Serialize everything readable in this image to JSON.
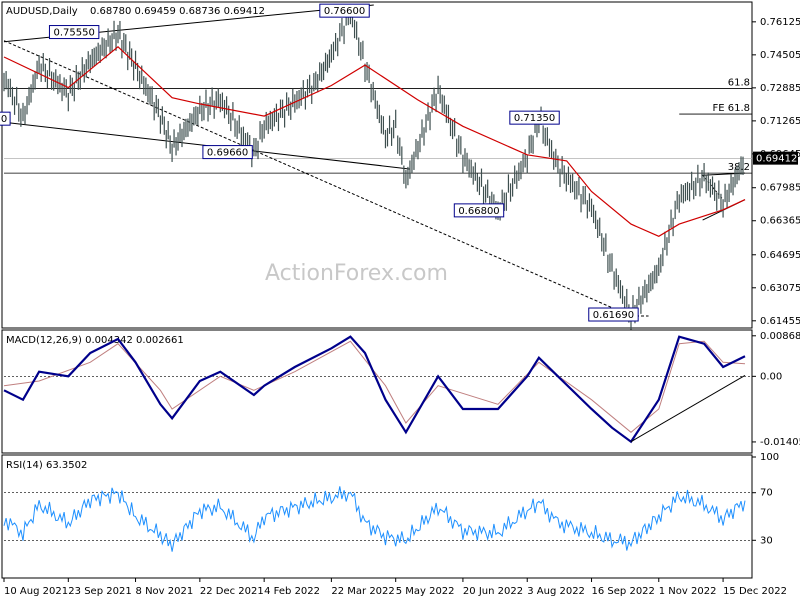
{
  "chart_data": {
    "type": "line",
    "instrument": "AUDUSD,Daily",
    "ohlc_header": "0.68780 0.69459 0.68736 0.69412",
    "watermark": "ActionForex.com",
    "x_ticks": [
      "10 Aug 2021",
      "23 Sep 2021",
      "8 Nov 2021",
      "22 Dec 2021",
      "4 Feb 2022",
      "22 Mar 2022",
      "5 May 2022",
      "20 Jun 2022",
      "3 Aug 2022",
      "16 Sep 2022",
      "1 Nov 2022",
      "15 Dec 2022"
    ],
    "price_panel": {
      "ylim": [
        0.612,
        0.77
      ],
      "y_ticks": [
        "0.76125",
        "0.74505",
        "0.72885",
        "0.71265",
        "0.69645",
        "0.67985",
        "0.66365",
        "0.64695",
        "0.63075",
        "0.61455"
      ],
      "last_price": "0.69412",
      "close_path": [
        [
          "10 Aug 2021",
          0.734
        ],
        [
          "23 Aug 2021",
          0.714
        ],
        [
          "3 Sep 2021",
          0.74
        ],
        [
          "23 Sep 2021",
          0.726
        ],
        [
          "8 Oct 2021",
          0.742
        ],
        [
          "27 Oct 2021",
          0.7555
        ],
        [
          "8 Nov 2021",
          0.739
        ],
        [
          "25 Nov 2021",
          0.715
        ],
        [
          "3 Dec 2021",
          0.6993
        ],
        [
          "22 Dec 2021",
          0.718
        ],
        [
          "5 Jan 2022",
          0.723
        ],
        [
          "28 Jan 2022",
          0.6966
        ],
        [
          "4 Feb 2022",
          0.71
        ],
        [
          "25 Feb 2022",
          0.722
        ],
        [
          "10 Mar 2022",
          0.73
        ],
        [
          "22 Mar 2022",
          0.745
        ],
        [
          "4 Apr 2022",
          0.766
        ],
        [
          "14 Apr 2022",
          0.74
        ],
        [
          "28 Apr 2022",
          0.705
        ],
        [
          "5 May 2022",
          0.71
        ],
        [
          "12 May 2022",
          0.683
        ],
        [
          "3 Jun 2022",
          0.728
        ],
        [
          "20 Jun 2022",
          0.695
        ],
        [
          "14 Jul 2022",
          0.668
        ],
        [
          "3 Aug 2022",
          0.695
        ],
        [
          "11 Aug 2022",
          0.7135
        ],
        [
          "24 Aug 2022",
          0.69
        ],
        [
          "16 Sep 2022",
          0.67
        ],
        [
          "30 Sep 2022",
          0.64
        ],
        [
          "13 Oct 2022",
          0.6169
        ],
        [
          "1 Nov 2022",
          0.64
        ],
        [
          "15 Nov 2022",
          0.675
        ],
        [
          "2 Dec 2022",
          0.685
        ],
        [
          "15 Dec 2022",
          0.672
        ],
        [
          "30 Dec 2022",
          0.6941
        ]
      ],
      "ma_path": [
        [
          "10 Aug 2021",
          0.744
        ],
        [
          "23 Sep 2021",
          0.729
        ],
        [
          "27 Oct 2021",
          0.749
        ],
        [
          "3 Dec 2021",
          0.724
        ],
        [
          "22 Dec 2021",
          0.721
        ],
        [
          "4 Feb 2022",
          0.715
        ],
        [
          "22 Mar 2022",
          0.73
        ],
        [
          "14 Apr 2022",
          0.74
        ],
        [
          "20 May 2022",
          0.723
        ],
        [
          "20 Jun 2022",
          0.71
        ],
        [
          "3 Aug 2022",
          0.696
        ],
        [
          "30 Aug 2022",
          0.693
        ],
        [
          "16 Sep 2022",
          0.678
        ],
        [
          "13 Oct 2022",
          0.662
        ],
        [
          "1 Nov 2022",
          0.656
        ],
        [
          "15 Nov 2022",
          0.662
        ],
        [
          "15 Dec 2022",
          0.669
        ],
        [
          "30 Dec 2022",
          0.674
        ]
      ],
      "levels": [
        {
          "label": "61.8",
          "value": 0.7285
        },
        {
          "label": "FE 61.8",
          "value": 0.716
        },
        {
          "label": "38.2",
          "value": 0.687
        }
      ],
      "annotations": [
        {
          "label": "0.75550",
          "x": "27 Sep 2021",
          "y": 0.7555
        },
        {
          "label": "0.76600",
          "x": "31 Mar 2022",
          "y": 0.766
        },
        {
          "label": "0.69660",
          "x": "10 Jan 2022",
          "y": 0.6966
        },
        {
          "label": "0.71350",
          "x": "8 Aug 2022",
          "y": 0.7135
        },
        {
          "label": "0.66800",
          "x": "1 Jul 2022",
          "y": 0.668
        },
        {
          "label": "0.61690",
          "x": "1 Oct 2022",
          "y": 0.6169
        },
        {
          "label": "0",
          "x": "10 Aug 2021",
          "y": 0.713
        }
      ]
    },
    "macd_panel": {
      "label": "MACD(12,26,9) 0.004342 0.002661",
      "ylim": [
        -0.016,
        0.0095
      ],
      "y_ticks": [
        "0.008687",
        "0.00",
        "-0.014056"
      ],
      "macd_path": [
        [
          "10 Aug 2021",
          -0.003
        ],
        [
          "23 Aug 2021",
          -0.005
        ],
        [
          "3 Sep 2021",
          0.001
        ],
        [
          "23 Sep 2021",
          0.0
        ],
        [
          "8 Oct 2021",
          0.005
        ],
        [
          "27 Oct 2021",
          0.008
        ],
        [
          "8 Nov 2021",
          0.003
        ],
        [
          "25 Nov 2021",
          -0.006
        ],
        [
          "3 Dec 2021",
          -0.009
        ],
        [
          "22 Dec 2021",
          -0.001
        ],
        [
          "5 Jan 2022",
          0.001
        ],
        [
          "28 Jan 2022",
          -0.004
        ],
        [
          "4 Feb 2022",
          -0.002
        ],
        [
          "25 Feb 2022",
          0.002
        ],
        [
          "22 Mar 2022",
          0.006
        ],
        [
          "4 Apr 2022",
          0.0085
        ],
        [
          "14 Apr 2022",
          0.005
        ],
        [
          "28 Apr 2022",
          -0.005
        ],
        [
          "12 May 2022",
          -0.012
        ],
        [
          "3 Jun 2022",
          0.0
        ],
        [
          "20 Jun 2022",
          -0.007
        ],
        [
          "14 Jul 2022",
          -0.007
        ],
        [
          "3 Aug 2022",
          0.0
        ],
        [
          "11 Aug 2022",
          0.004
        ],
        [
          "24 Aug 2022",
          0.0
        ],
        [
          "16 Sep 2022",
          -0.007
        ],
        [
          "30 Sep 2022",
          -0.011
        ],
        [
          "13 Oct 2022",
          -0.014
        ],
        [
          "1 Nov 2022",
          -0.005
        ],
        [
          "15 Nov 2022",
          0.0085
        ],
        [
          "2 Dec 2022",
          0.007
        ],
        [
          "15 Dec 2022",
          0.002
        ],
        [
          "30 Dec 2022",
          0.0043
        ]
      ],
      "signal_path": [
        [
          "10 Aug 2021",
          -0.002
        ],
        [
          "3 Sep 2021",
          -0.001
        ],
        [
          "8 Oct 2021",
          0.003
        ],
        [
          "27 Oct 2021",
          0.007
        ],
        [
          "25 Nov 2021",
          -0.003
        ],
        [
          "3 Dec 2021",
          -0.007
        ],
        [
          "5 Jan 2022",
          0.0
        ],
        [
          "28 Jan 2022",
          -0.003
        ],
        [
          "25 Feb 2022",
          0.001
        ],
        [
          "4 Apr 2022",
          0.0075
        ],
        [
          "28 Apr 2022",
          -0.002
        ],
        [
          "12 May 2022",
          -0.01
        ],
        [
          "3 Jun 2022",
          -0.002
        ],
        [
          "14 Jul 2022",
          -0.006
        ],
        [
          "11 Aug 2022",
          0.003
        ],
        [
          "16 Sep 2022",
          -0.005
        ],
        [
          "13 Oct 2022",
          -0.012
        ],
        [
          "1 Nov 2022",
          -0.007
        ],
        [
          "15 Nov 2022",
          0.007
        ],
        [
          "2 Dec 2022",
          0.0075
        ],
        [
          "15 Dec 2022",
          0.003
        ],
        [
          "30 Dec 2022",
          0.0027
        ]
      ]
    },
    "rsi_panel": {
      "label": "RSI(14) 63.3502",
      "ylim": [
        0,
        100
      ],
      "y_ticks": [
        "100",
        "70",
        "30",
        "0"
      ],
      "rsi_path": [
        [
          "10 Aug 2021",
          48
        ],
        [
          "23 Aug 2021",
          36
        ],
        [
          "3 Sep 2021",
          60
        ],
        [
          "23 Sep 2021",
          44
        ],
        [
          "8 Oct 2021",
          64
        ],
        [
          "27 Oct 2021",
          70
        ],
        [
          "8 Nov 2021",
          50
        ],
        [
          "25 Nov 2021",
          34
        ],
        [
          "3 Dec 2021",
          26
        ],
        [
          "22 Dec 2021",
          55
        ],
        [
          "5 Jan 2022",
          58
        ],
        [
          "28 Jan 2022",
          32
        ],
        [
          "4 Feb 2022",
          50
        ],
        [
          "25 Feb 2022",
          58
        ],
        [
          "22 Mar 2022",
          66
        ],
        [
          "4 Apr 2022",
          70
        ],
        [
          "14 Apr 2022",
          45
        ],
        [
          "28 Apr 2022",
          33
        ],
        [
          "12 May 2022",
          30
        ],
        [
          "3 Jun 2022",
          58
        ],
        [
          "20 Jun 2022",
          38
        ],
        [
          "14 Jul 2022",
          36
        ],
        [
          "3 Aug 2022",
          55
        ],
        [
          "11 Aug 2022",
          62
        ],
        [
          "24 Aug 2022",
          45
        ],
        [
          "16 Sep 2022",
          36
        ],
        [
          "30 Sep 2022",
          30
        ],
        [
          "13 Oct 2022",
          28
        ],
        [
          "1 Nov 2022",
          50
        ],
        [
          "15 Nov 2022",
          67
        ],
        [
          "2 Dec 2022",
          60
        ],
        [
          "15 Dec 2022",
          48
        ],
        [
          "30 Dec 2022",
          63.35
        ]
      ]
    }
  }
}
